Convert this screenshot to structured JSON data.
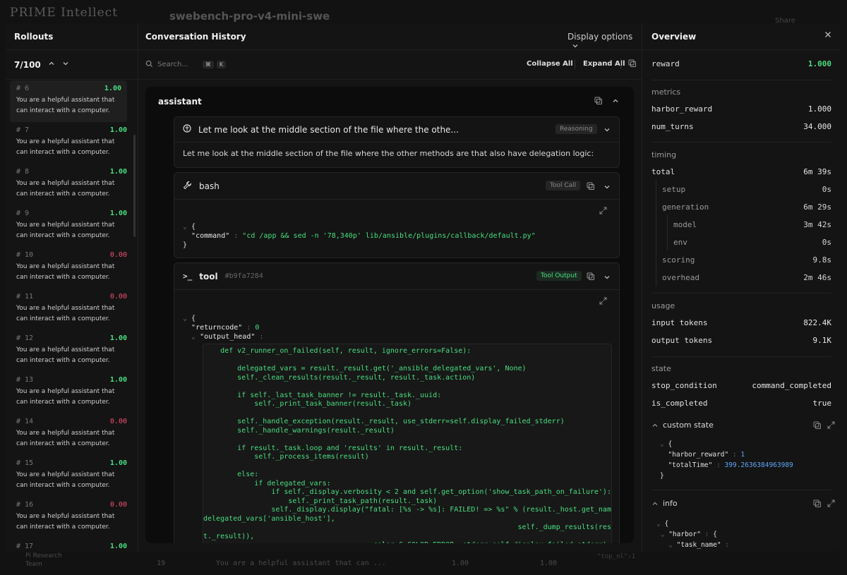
{
  "backdrop": {
    "logo": "PRIME Intellect",
    "title": "swebench-pro-v4-mini-swe",
    "share": "Share",
    "team_name": "Pi Research",
    "team_sub": "Team",
    "row_num": "19",
    "row_text": "You are a helpful assistant that can ...",
    "row_val1": "1.00",
    "row_val2": "1.00",
    "row_code": "\"top_nl\":1"
  },
  "rollouts": {
    "title": "Rollouts",
    "counter": "7/100",
    "items": [
      {
        "id": "# 6",
        "score": "1.00",
        "status": "good",
        "text": "You are a helpful assistant that can interact with a computer."
      },
      {
        "id": "# 7",
        "score": "1.00",
        "status": "good",
        "text": "You are a helpful assistant that can interact with a computer."
      },
      {
        "id": "# 8",
        "score": "1.00",
        "status": "good",
        "text": "You are a helpful assistant that can interact with a computer."
      },
      {
        "id": "# 9",
        "score": "1.00",
        "status": "good",
        "text": "You are a helpful assistant that can interact with a computer."
      },
      {
        "id": "# 10",
        "score": "0.00",
        "status": "bad",
        "text": "You are a helpful assistant that can interact with a computer."
      },
      {
        "id": "# 11",
        "score": "0.00",
        "status": "bad",
        "text": "You are a helpful assistant that can interact with a computer."
      },
      {
        "id": "# 12",
        "score": "1.00",
        "status": "good",
        "text": "You are a helpful assistant that can interact with a computer."
      },
      {
        "id": "# 13",
        "score": "1.00",
        "status": "good",
        "text": "You are a helpful assistant that can interact with a computer."
      },
      {
        "id": "# 14",
        "score": "0.00",
        "status": "bad",
        "text": "You are a helpful assistant that can interact with a computer."
      },
      {
        "id": "# 15",
        "score": "1.00",
        "status": "good",
        "text": "You are a helpful assistant that can interact with a computer."
      },
      {
        "id": "# 16",
        "score": "0.00",
        "status": "bad",
        "text": "You are a helpful assistant that can interact with a computer."
      },
      {
        "id": "# 17",
        "score": "1.00",
        "status": "good",
        "text": ""
      }
    ]
  },
  "conversation": {
    "title": "Conversation History",
    "display_options": "Display options",
    "search_placeholder": "Search...",
    "kbd1": "⌘",
    "kbd2": "K",
    "collapse_all": "Collapse All",
    "expand_all": "Expand All",
    "role": "assistant",
    "reasoning": {
      "summary": "Let me look at the middle section of the file where the othe...",
      "badge": "Reasoning",
      "text": "Let me look at the middle section of the file where the other methods are that also have delegation logic:"
    },
    "bash": {
      "label": "bash",
      "badge": "Tool Call",
      "brace_open": "{",
      "key": "\"command\"",
      "value": "\"cd /app && sed -n '78,340p' lib/ansible/plugins/callback/default.py\"",
      "brace_close": "}"
    },
    "tool": {
      "label": "tool",
      "hash": "#b9fa7284",
      "badge": "Tool Output",
      "brace_open": "{",
      "returncode_key": "\"returncode\"",
      "returncode_val": "0",
      "output_key": "\"output_head\"",
      "output": "    def v2_runner_on_failed(self, result, ignore_errors=False):\n\n        delegated_vars = result._result.get('_ansible_delegated_vars', None)\n        self._clean_results(result._result, result._task.action)\n\n        if self._last_task_banner != result._task._uuid:\n            self._print_task_banner(result._task)\n\n        self._handle_exception(result._result, use_stderr=self.display_failed_stderr)\n        self._handle_warnings(result._result)\n\n        if result._task.loop and 'results' in result._result:\n            self._process_items(result)\n\n        else:\n            if delegated_vars:\n                if self._display.verbosity < 2 and self.get_option('show_task_path_on_failure'):\n                    self._print_task_path(result._task)\n                self._display.display(\"fatal: [%s -> %s]: FAILED! => %s\" % (result._host.get_name(),\ndelegated_vars['ansible_host'],\n                                                                          self._dump_results(resul\nt._result)),\n                                        color=C.COLOR_ERROR, stderr=self.display_failed_stderr)"
    }
  },
  "overview": {
    "title": "Overview",
    "reward_label": "reward",
    "reward_value": "1.000",
    "metrics_label": "metrics",
    "harbor_reward_label": "harbor_reward",
    "harbor_reward_value": "1.000",
    "num_turns_label": "num_turns",
    "num_turns_value": "34.000",
    "timing_label": "timing",
    "total_label": "total",
    "total_value": "6m 39s",
    "setup_label": "setup",
    "setup_value": "0s",
    "generation_label": "generation",
    "generation_value": "6m 29s",
    "model_label": "model",
    "model_value": "3m 42s",
    "env_label": "env",
    "env_value": "0s",
    "scoring_label": "scoring",
    "scoring_value": "9.8s",
    "overhead_label": "overhead",
    "overhead_value": "2m 46s",
    "usage_label": "usage",
    "input_tokens_label": "input tokens",
    "input_tokens_value": "822.4K",
    "output_tokens_label": "output tokens",
    "output_tokens_value": "9.1K",
    "state_label": "state",
    "stop_condition_label": "stop_condition",
    "stop_condition_value": "command_completed",
    "is_completed_label": "is_completed",
    "is_completed_value": "true",
    "custom_state_label": "custom state",
    "custom_state": {
      "brace_open": "{",
      "k1": "\"harbor_reward\"",
      "v1": "1",
      "k2": "\"totalTime\"",
      "v2": "399.2636384963989",
      "brace_close": "}"
    },
    "info_label": "info",
    "info": {
      "brace_open": "{",
      "k1": "\"harbor\"",
      "k1_open": "{",
      "k2": "\"task_name\""
    }
  },
  "colors": {
    "accent_green": "#4ade80",
    "fail_red": "#f0506e",
    "number_blue": "#60a5fa"
  }
}
